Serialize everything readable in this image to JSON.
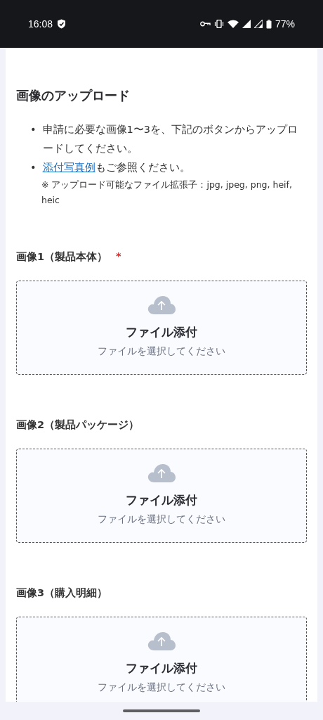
{
  "status_bar": {
    "time": "16:08",
    "battery": "77%"
  },
  "section": {
    "title": "画像のアップロード",
    "bullet_marker": "•",
    "bullets": [
      {
        "kind": "text",
        "text": "申請に必要な画像1〜3を、下記のボタンからアップロードしてください。"
      },
      {
        "kind": "link",
        "link": "添付写真例",
        "text": "もご参照ください。"
      }
    ],
    "note": "※ アップロード可能なファイル拡張子：jpg, jpeg, png, heif, heic"
  },
  "uploads": [
    {
      "label": "画像1（製品本体）",
      "required": true,
      "required_mark": "*",
      "button": "ファイル添付",
      "hint": "ファイルを選択してください"
    },
    {
      "label": "画像2（製品パッケージ）",
      "required": false,
      "button": "ファイル添付",
      "hint": "ファイルを選択してください"
    },
    {
      "label": "画像3（購入明細）",
      "required": false,
      "button": "ファイル添付",
      "hint": "ファイルを選択してください"
    }
  ]
}
